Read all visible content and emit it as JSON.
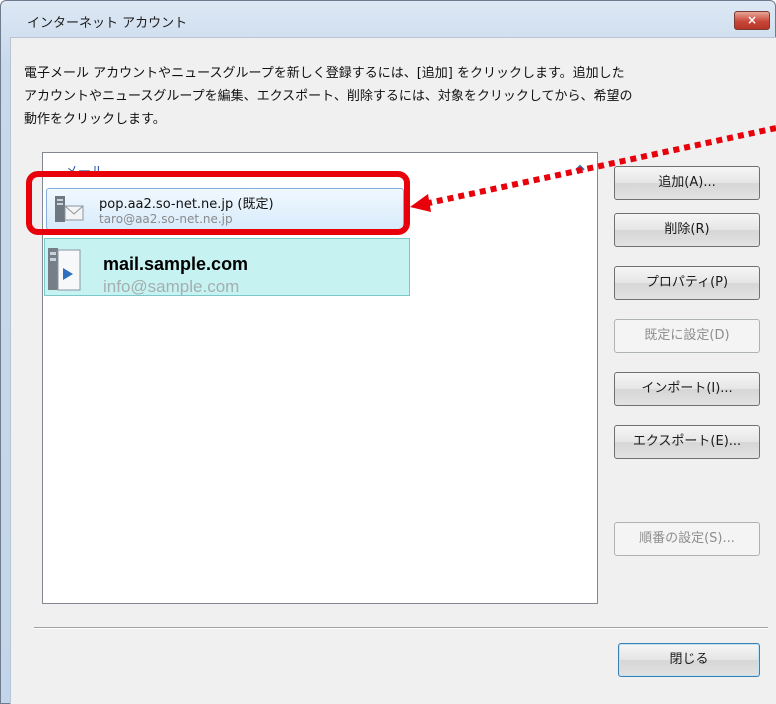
{
  "window": {
    "title": "インターネット アカウント",
    "close_glyph": "×"
  },
  "instructions": "電子メール アカウントやニュースグループを新しく登録するには、[追加] をクリックします。追加した\nアカウントやニュースグループを編集、エクスポート、削除するには、対象をクリックしてから、希望の\n動作をクリックします。",
  "list": {
    "group_header": "メール",
    "collapse_icon": "collapse-chevron-icon",
    "accounts": [
      {
        "name": "pop.aa2.so-net.ne.jp (既定)",
        "email": "taro@aa2.so-net.ne.jp",
        "icon": "mail-server-icon"
      }
    ],
    "drag_item": {
      "name": "mail.sample.com",
      "email": "info@sample.com",
      "icon": "mail-server-icon"
    }
  },
  "buttons": {
    "add": "追加(A)...",
    "remove": "削除(R)",
    "properties": "プロパティ(P)",
    "set_default": "既定に設定(D)",
    "import": "インポート(I)...",
    "export": "エクスポート(E)...",
    "set_order": "順番の設定(S)...",
    "close": "閉じる"
  },
  "annotation": {
    "highlight_color": "#e8000a",
    "arrow_color": "#e8000a"
  }
}
